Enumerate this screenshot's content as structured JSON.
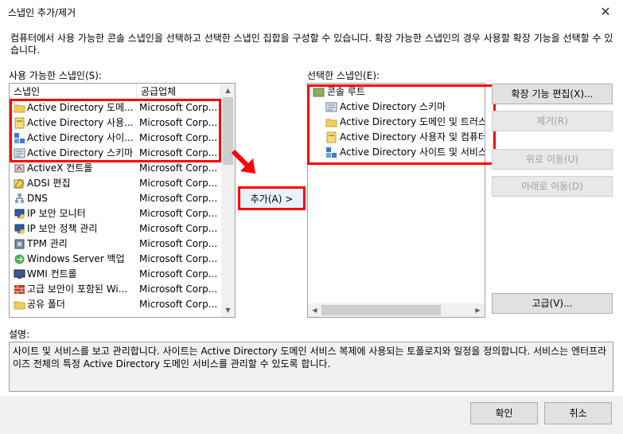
{
  "window": {
    "title": "스냅인 추가/제거",
    "close_glyph": "✕"
  },
  "description": "컴퓨터에서 사용 가능한 콘솔 스냅인을 선택하고 선택한 스냅인 집합을 구성할 수 있습니다. 확장 가능한 스냅인의 경우 사용할 확장 기능을 선택할 수 있습니다.",
  "available": {
    "label": "사용 가능한 스냅인(S):",
    "col_name": "스냅인",
    "col_vendor": "공급업체",
    "items": [
      {
        "name": "Active Directory 도메...",
        "vendor": "Microsoft Corp...",
        "icon": "ad-domains-icon"
      },
      {
        "name": "Active Directory 사용...",
        "vendor": "Microsoft Corp...",
        "icon": "ad-users-icon"
      },
      {
        "name": "Active Directory 사이...",
        "vendor": "Microsoft Corp...",
        "icon": "ad-sites-icon"
      },
      {
        "name": "Active Directory 스키마",
        "vendor": "Microsoft Corp...",
        "icon": "ad-schema-icon"
      },
      {
        "name": "ActiveX 컨트롤",
        "vendor": "Microsoft Corp...",
        "icon": "activex-icon"
      },
      {
        "name": "ADSI 편집",
        "vendor": "Microsoft Corp...",
        "icon": "adsi-edit-icon"
      },
      {
        "name": "DNS",
        "vendor": "Microsoft Corp...",
        "icon": "dns-icon"
      },
      {
        "name": "IP 보안 모니터",
        "vendor": "Microsoft Corp...",
        "icon": "ip-security-monitor-icon"
      },
      {
        "name": "IP 보안 정책 관리",
        "vendor": "Microsoft Corp...",
        "icon": "ip-security-policy-icon"
      },
      {
        "name": "TPM 관리",
        "vendor": "Microsoft Corp...",
        "icon": "tpm-icon"
      },
      {
        "name": "Windows Server 백업",
        "vendor": "Microsoft Corp...",
        "icon": "backup-icon"
      },
      {
        "name": "WMI 컨트롤",
        "vendor": "Microsoft Corp...",
        "icon": "wmi-icon"
      },
      {
        "name": "고급 보안이 포함된 Wi...",
        "vendor": "Microsoft Corp...",
        "icon": "firewall-icon"
      },
      {
        "name": "공유 폴더",
        "vendor": "Microsoft Corp...",
        "icon": "shared-folders-icon"
      }
    ]
  },
  "add_button": "추가(A) >",
  "selected": {
    "label": "선택한 스냅인(E):",
    "root": "콘솔 루트",
    "items": [
      {
        "name": "Active Directory 스키마",
        "icon": "ad-schema-icon"
      },
      {
        "name": "Active Directory 도메인 및 트러스",
        "icon": "ad-domains-icon"
      },
      {
        "name": "Active Directory 사용자 및 컴퓨터",
        "icon": "ad-users-icon"
      },
      {
        "name": "Active Directory 사이트 및 서비스",
        "icon": "ad-sites-icon"
      }
    ]
  },
  "side_buttons": {
    "edit_ext": "확장 기능 편집(X)...",
    "remove": "제거(R)",
    "move_up": "위로 이동(U)",
    "move_down": "아래로 이동(D)",
    "advanced": "고급(V)..."
  },
  "info": {
    "label": "설명:",
    "text": "사이트 및 서비스를 보고 관리합니다. 사이트는 Active Directory 도메인 서비스 복제에 사용되는 토폴로지와 일정을 정의합니다. 서비스는 엔터프라이즈 전체의 특정 Active Directory 도메인 서비스를 관리할 수 있도록 합니다."
  },
  "footer": {
    "ok": "확인",
    "cancel": "취소"
  },
  "colors": {
    "highlight": "#ff0000",
    "accent": "#0078d7"
  }
}
